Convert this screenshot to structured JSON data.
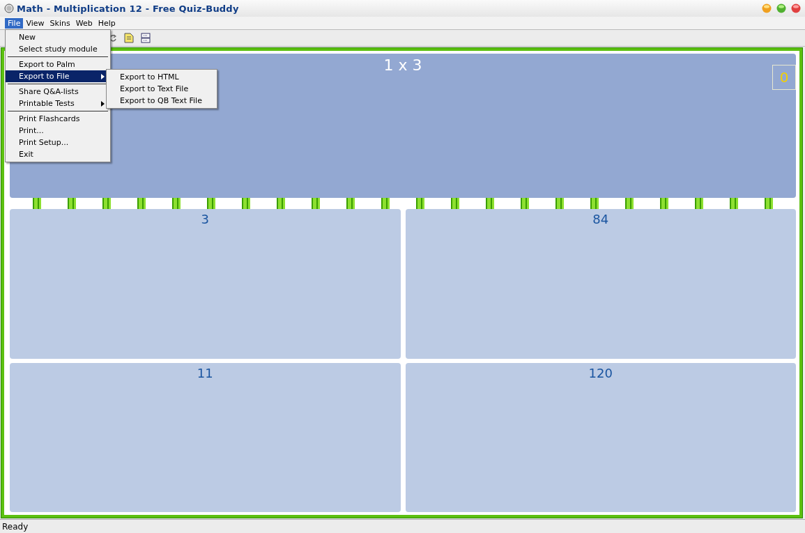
{
  "window": {
    "title": "Math - Multiplication 12 - Free Quiz-Buddy"
  },
  "menu_bar": [
    {
      "label": "File",
      "selected": true
    },
    {
      "label": "View",
      "selected": false
    },
    {
      "label": "Skins",
      "selected": false
    },
    {
      "label": "Web",
      "selected": false
    },
    {
      "label": "Help",
      "selected": false
    }
  ],
  "file_menu": [
    {
      "kind": "item",
      "label": "New",
      "selected": false,
      "submenu": false
    },
    {
      "kind": "item",
      "label": "Select study module",
      "selected": false,
      "submenu": false
    },
    {
      "kind": "separator"
    },
    {
      "kind": "item",
      "label": "Export to Palm",
      "selected": false,
      "submenu": false
    },
    {
      "kind": "item",
      "label": "Export to File",
      "selected": true,
      "submenu": true
    },
    {
      "kind": "separator"
    },
    {
      "kind": "item",
      "label": "Share Q&A-lists",
      "selected": false,
      "submenu": false
    },
    {
      "kind": "item",
      "label": "Printable Tests",
      "selected": false,
      "submenu": true
    },
    {
      "kind": "separator"
    },
    {
      "kind": "item",
      "label": "Print Flashcards",
      "selected": false,
      "submenu": false
    },
    {
      "kind": "item",
      "label": "Print...",
      "selected": false,
      "submenu": false
    },
    {
      "kind": "item",
      "label": "Print Setup...",
      "selected": false,
      "submenu": false
    },
    {
      "kind": "item",
      "label": "Exit",
      "selected": false,
      "submenu": false
    }
  ],
  "export_submenu": [
    "Export to HTML",
    "Export to Text File",
    "Export to QB Text File"
  ],
  "question": {
    "text": "1 x 3",
    "score": "0"
  },
  "answers": [
    "3",
    "84",
    "11",
    "120"
  ],
  "status_bar": "Ready"
}
